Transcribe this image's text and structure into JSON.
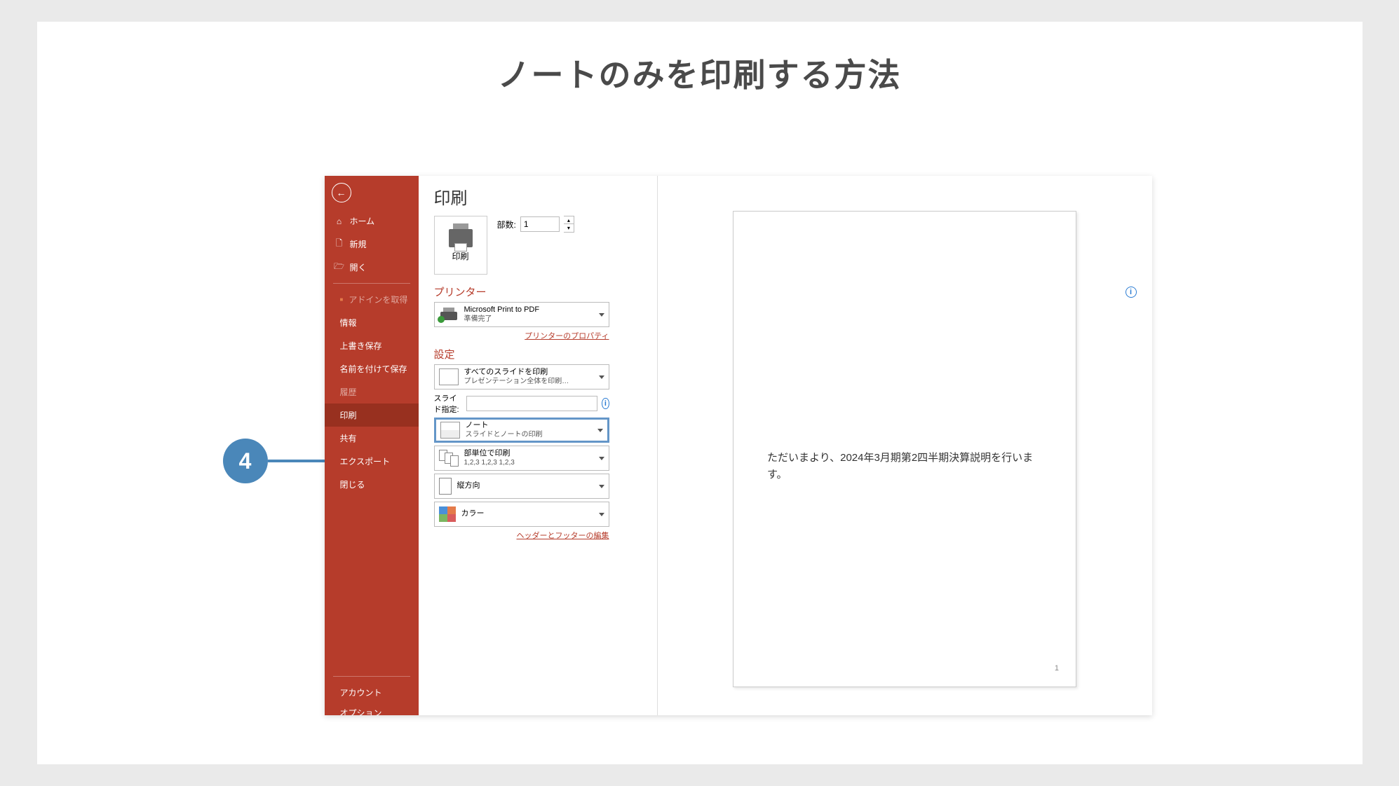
{
  "title": "ノートのみを印刷する方法",
  "callout_number": "4",
  "sidebar": {
    "home": "ホーム",
    "new": "新規",
    "open": "開く",
    "addins": "アドインを取得",
    "info": "情報",
    "save": "上書き保存",
    "saveas": "名前を付けて保存",
    "history": "履歴",
    "print": "印刷",
    "share": "共有",
    "export": "エクスポート",
    "close": "閉じる",
    "account": "アカウント",
    "options": "オプション"
  },
  "print": {
    "heading": "印刷",
    "button": "印刷",
    "copies_label": "部数:",
    "copies_value": "1",
    "printer_section": "プリンター",
    "printer_name": "Microsoft Print to PDF",
    "printer_status": "準備完了",
    "printer_props": "プリンターのプロパティ",
    "settings_section": "設定",
    "all_slides_t1": "すべてのスライドを印刷",
    "all_slides_t2": "プレゼンテーション全体を印刷…",
    "slide_spec_label": "スライド指定:",
    "notes_t1": "ノート",
    "notes_t2": "スライドとノートの印刷",
    "collate_t1": "部単位で印刷",
    "collate_t2": "1,2,3   1,2,3   1,2,3",
    "orient": "縦方向",
    "color": "カラー",
    "header_footer": "ヘッダーとフッターの編集"
  },
  "preview": {
    "text": "ただいまより、2024年3月期第2四半期決算説明を行います。",
    "page": "1"
  }
}
